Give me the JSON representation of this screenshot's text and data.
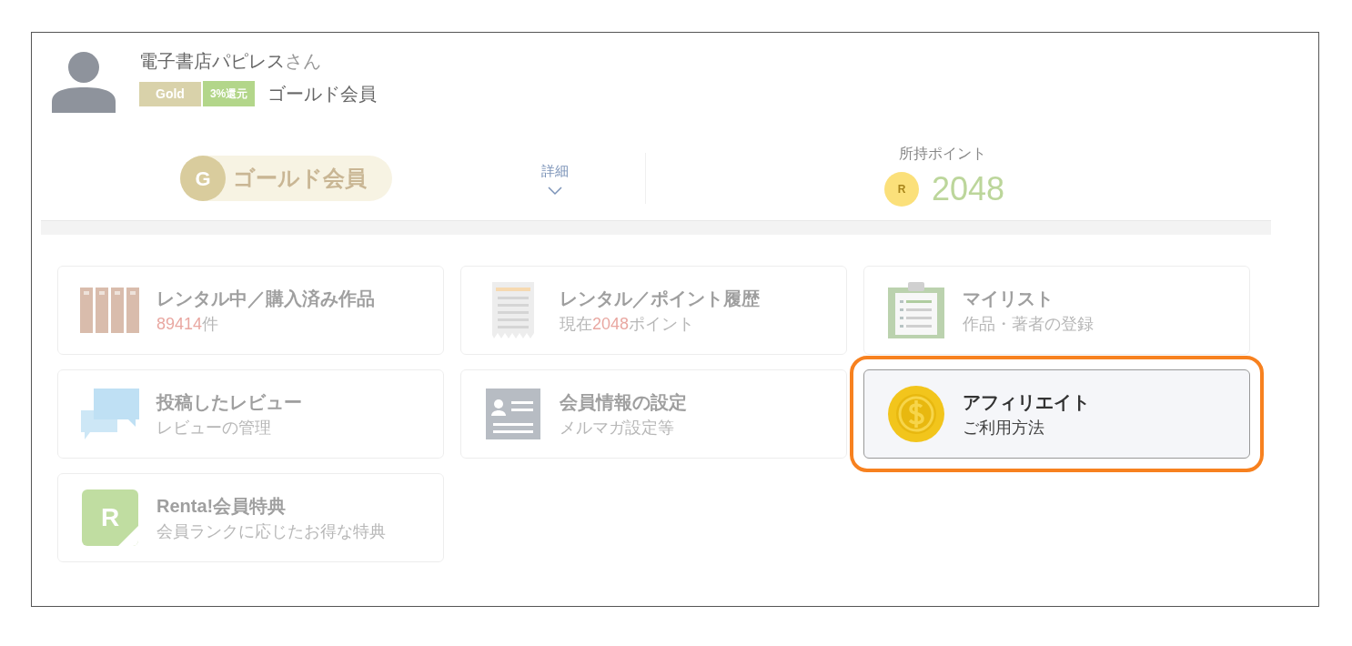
{
  "user": {
    "name": "電子書店パピレス",
    "honorific": "さん",
    "rank_badge": "Gold",
    "rebate_badge": "3%還元",
    "rank_label": "ゴールド会員"
  },
  "rank_pill": {
    "letter": "G",
    "label": "ゴールド会員"
  },
  "details_toggle": {
    "label": "詳細",
    "expanded": false
  },
  "points": {
    "label": "所持ポイント",
    "coin_letter": "R",
    "value": "2048"
  },
  "cards": [
    {
      "kind": "books",
      "title": "レンタル中／購入済み作品",
      "subtitle": [
        {
          "text": "89414",
          "accent": true
        },
        {
          "text": "件",
          "accent": false
        }
      ],
      "highlighted": false
    },
    {
      "kind": "receipt",
      "title": "レンタル／ポイント履歴",
      "subtitle": [
        {
          "text": "現在",
          "accent": false
        },
        {
          "text": "2048",
          "accent": true
        },
        {
          "text": "ポイント",
          "accent": false
        }
      ],
      "highlighted": false
    },
    {
      "kind": "clipboard",
      "title": "マイリスト",
      "subtitle": [
        {
          "text": "作品・著者の登録",
          "accent": false
        }
      ],
      "highlighted": false
    },
    {
      "kind": "chat",
      "title": "投稿したレビュー",
      "subtitle": [
        {
          "text": "レビューの管理",
          "accent": false
        }
      ],
      "highlighted": false
    },
    {
      "kind": "idcard",
      "title": "会員情報の設定",
      "subtitle": [
        {
          "text": "メルマガ設定等",
          "accent": false
        }
      ],
      "highlighted": false
    },
    {
      "kind": "coin",
      "title": "アフィリエイト",
      "subtitle": [
        {
          "text": "ご利用方法",
          "accent": false
        }
      ],
      "highlighted": true
    },
    {
      "kind": "letter",
      "letter": "R",
      "title": "Renta!会員特典",
      "subtitle": [
        {
          "text": "会員ランクに応じたお得な特典",
          "accent": false
        }
      ],
      "highlighted": false
    }
  ]
}
